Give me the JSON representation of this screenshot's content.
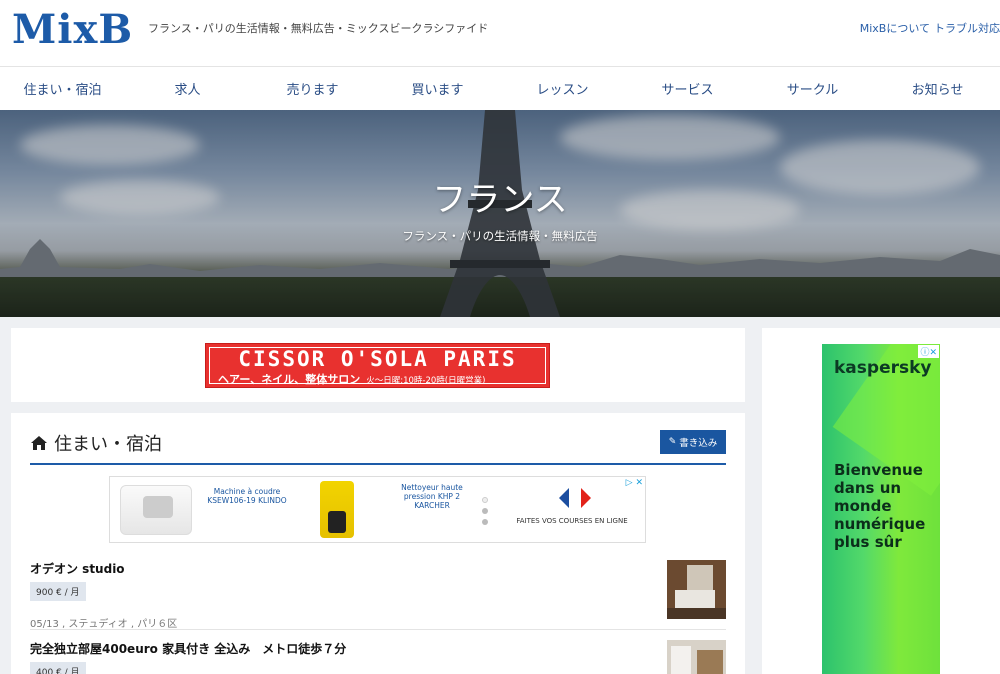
{
  "header": {
    "logo": "MixB",
    "tagline": "フランス・パリの生活情報・無料広告・ミックスビークラシファイド",
    "links": [
      "MixBについて",
      "トラブル対応"
    ]
  },
  "nav": {
    "items": [
      "住まい・宿泊",
      "求人",
      "売ります",
      "買います",
      "レッスン",
      "サービス",
      "サークル",
      "お知らせ"
    ]
  },
  "hero": {
    "title": "フランス",
    "subtitle": "フランス・パリの生活情報・無料広告"
  },
  "top_ad": {
    "title": "CISSOR O'SOLA PARIS",
    "line": "ヘアー、ネイル、整体サロン",
    "hours": "火～日曜:10時-20時(日曜営業)"
  },
  "section": {
    "title": "住まい・宿泊",
    "post_button": "書き込み"
  },
  "product_ad": {
    "product1": "Machine à coudre KSEW106-19 KLINDO",
    "product2": "Nettoyeur haute pression KHP 2 KARCHER",
    "slogan": "FAITES VOS COURSES EN LIGNE"
  },
  "listings": [
    {
      "title": "オデオン studio",
      "price": "900 € / 月",
      "meta": "05/13 , ステュディオ , パリ６区"
    },
    {
      "title": "完全独立部屋400euro 家具付き 全込み　メトロ徒歩７分",
      "price": "400 € / 月",
      "meta": ""
    }
  ],
  "sidebar_ad": {
    "logo": "kaspersky",
    "text": "Bienvenue dans un monde numérique plus sûr"
  },
  "colors": {
    "brand_blue": "#1d5ba8",
    "nav_text": "#2a4d85",
    "button_blue": "#1a56a0",
    "ad_red": "#e8312f",
    "kaspersky_green": "#53d96a"
  }
}
